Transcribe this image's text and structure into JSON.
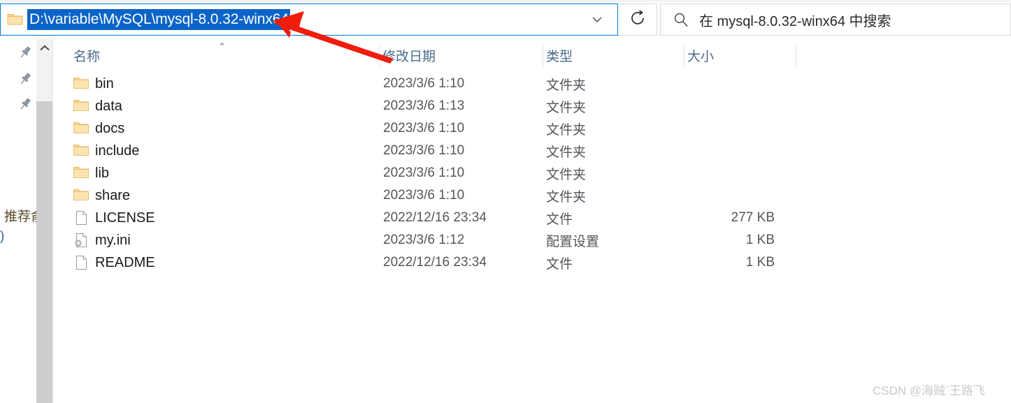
{
  "addressbar": {
    "path": "D:\\variable\\MySQL\\mysql-8.0.32-winx64",
    "folder_icon": "folder-icon",
    "dropdown_icon": "chevron-down-icon"
  },
  "refresh": {
    "icon": "refresh-icon",
    "label": ""
  },
  "search": {
    "icon": "search-icon",
    "placeholder": "在 mysql-8.0.32-winx64 中搜索"
  },
  "navpane": {
    "pins": [
      "pin-icon",
      "pin-icon",
      "pin-icon"
    ],
    "clipped_text_1": "推荐俞",
    "clipped_text_2": ")",
    "scroll_up_icon": "chevron-up-icon"
  },
  "columns": {
    "name": "名称",
    "date_modified": "修改日期",
    "type": "类型",
    "size": "大小",
    "sort_indicator": "⌃"
  },
  "files": [
    {
      "icon": "folder-icon",
      "name": "bin",
      "date": "2023/3/6 1:10",
      "type": "文件夹",
      "size": ""
    },
    {
      "icon": "folder-icon",
      "name": "data",
      "date": "2023/3/6 1:13",
      "type": "文件夹",
      "size": ""
    },
    {
      "icon": "folder-icon",
      "name": "docs",
      "date": "2023/3/6 1:10",
      "type": "文件夹",
      "size": ""
    },
    {
      "icon": "folder-icon",
      "name": "include",
      "date": "2023/3/6 1:10",
      "type": "文件夹",
      "size": ""
    },
    {
      "icon": "folder-icon",
      "name": "lib",
      "date": "2023/3/6 1:10",
      "type": "文件夹",
      "size": ""
    },
    {
      "icon": "folder-icon",
      "name": "share",
      "date": "2023/3/6 1:10",
      "type": "文件夹",
      "size": ""
    },
    {
      "icon": "file-icon",
      "name": "LICENSE",
      "date": "2022/12/16 23:34",
      "type": "文件",
      "size": "277 KB"
    },
    {
      "icon": "config-file-icon",
      "name": "my.ini",
      "date": "2023/3/6 1:12",
      "type": "配置设置",
      "size": "1 KB"
    },
    {
      "icon": "file-icon",
      "name": "README",
      "date": "2022/12/16 23:34",
      "type": "文件",
      "size": "1 KB"
    }
  ],
  "annotation": {
    "arrow_icon": "red-arrow-icon",
    "color": "#f01c0c"
  },
  "watermark": {
    "text": "CSDN @海贼`王路飞"
  },
  "colors": {
    "accent": "#0078d7",
    "selection": "#0a64c8",
    "header_text": "#4a6b8a",
    "annotation_red": "#f01c0c",
    "folder_yellow": "#fbd38a"
  }
}
